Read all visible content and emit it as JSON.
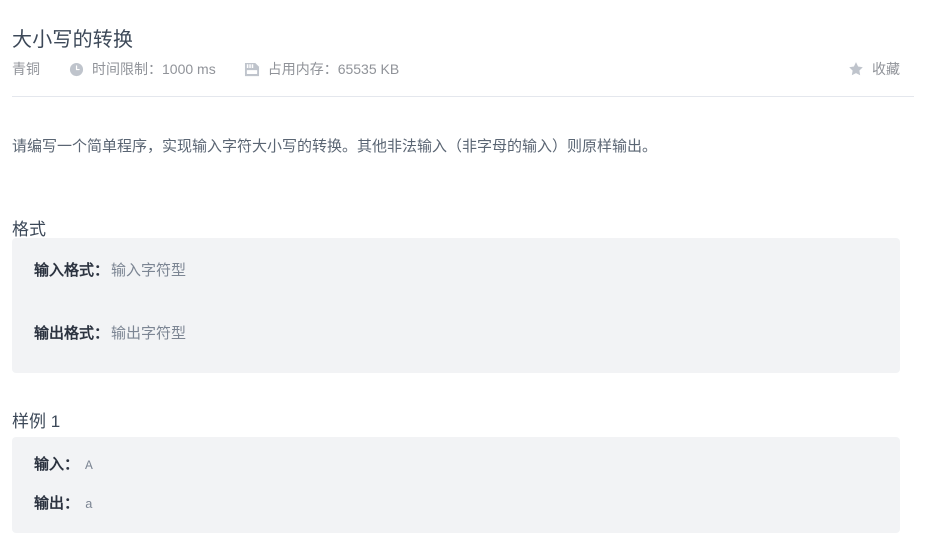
{
  "problem": {
    "title": "大小写的转换",
    "description": "请编写一个简单程序，实现输入字符大小写的转换。其他非法输入（非字母的输入）则原样输出。"
  },
  "meta": {
    "difficulty_label": "青铜",
    "time_limit_label": "时间限制：",
    "time_limit_value": "1000 ms",
    "memory_label": "占用内存：",
    "memory_value": "65535 KB",
    "favorite_label": "收藏",
    "clock_icon": "clock-icon",
    "memory_icon": "memory-card-icon",
    "star_icon": "star-icon"
  },
  "format_section": {
    "heading": "格式",
    "rows": [
      {
        "key": "输入格式：",
        "value": "输入字符型"
      },
      {
        "key": "输出格式：",
        "value": "输出字符型"
      }
    ]
  },
  "sample_section": {
    "heading": "样例 1",
    "rows": [
      {
        "key": "输入：",
        "value": "A"
      },
      {
        "key": "输出：",
        "value": "a"
      }
    ]
  },
  "colors": {
    "panel_bg": "#f2f3f5",
    "text_primary": "#3c4858",
    "text_muted": "#909399",
    "divider": "#e4e7ed",
    "page_bg": "#ffffff"
  }
}
